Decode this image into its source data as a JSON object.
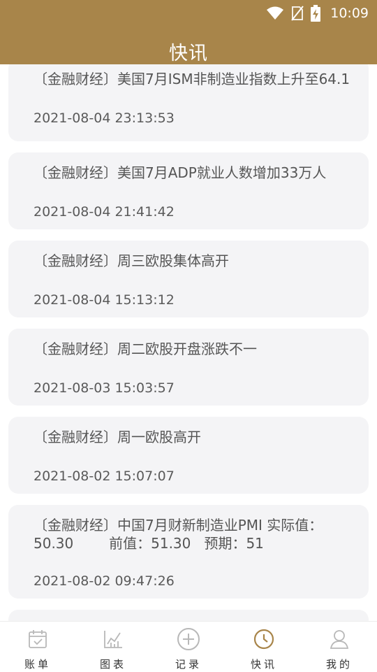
{
  "status": {
    "time": "10:09"
  },
  "header": {
    "title": "快讯"
  },
  "feed": {
    "items": [
      {
        "title": "〔金融财经〕美国7月ISM非制造业指数上升至64.1",
        "time": "2021-08-04 23:13:53"
      },
      {
        "title": "〔金融财经〕美国7月ADP就业人数增加33万人",
        "time": "2021-08-04 21:41:42"
      },
      {
        "title": "〔金融财经〕周三欧股集体高开",
        "time": "2021-08-04 15:13:12"
      },
      {
        "title": "〔金融财经〕周二欧股开盘涨跌不一",
        "time": "2021-08-03 15:03:57"
      },
      {
        "title": "〔金融财经〕周一欧股高开",
        "time": "2021-08-02 15:07:07"
      },
      {
        "title": "〔金融财经〕中国7月财新制造业PMI 实际值：\n50.30        前值：51.30   预期：51",
        "time": "2021-08-02 09:47:26"
      }
    ]
  },
  "tabbar": {
    "tabs": [
      {
        "label": "账单",
        "icon": "calendar-check-icon"
      },
      {
        "label": "图表",
        "icon": "chart-icon"
      },
      {
        "label": "记录",
        "icon": "plus-circle-icon"
      },
      {
        "label": "快讯",
        "icon": "clock-icon",
        "active": true
      },
      {
        "label": "我的",
        "icon": "user-icon"
      }
    ],
    "active_color": "#a8854a",
    "inactive_color": "#b8b8b8"
  }
}
